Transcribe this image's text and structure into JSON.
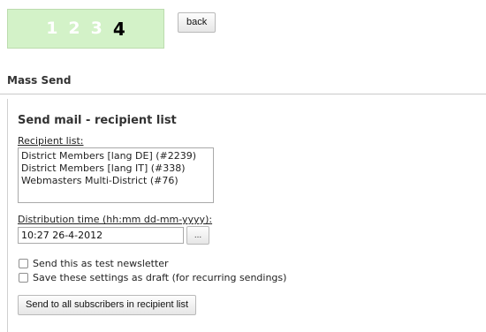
{
  "wizard": {
    "steps": [
      "1",
      "2",
      "3",
      "4"
    ],
    "current_step": "4",
    "back_label": "back"
  },
  "section": {
    "title": "Mass Send"
  },
  "form": {
    "title": "Send mail - recipient list",
    "recipient_label": "Recipient list:",
    "recipients": [
      "District Members [lang DE] (#2239)",
      "District Members [lang IT] (#338)",
      "Webmasters Multi-District (#76)"
    ],
    "distribution_label": "Distribution time (hh:mm dd-mm-yyyy):",
    "distribution_value": "10:27 26-4-2012",
    "picker_label": "...",
    "test_checkbox_label": "Send this as test newsletter",
    "draft_checkbox_label": "Save these settings as draft (for recurring sendings)",
    "submit_label": "Send to all subscribers in recipient list"
  },
  "colors": {
    "wizard_bg": "#d3f2c8",
    "step_inactive": "#ffffff",
    "step_active": "#000000"
  }
}
